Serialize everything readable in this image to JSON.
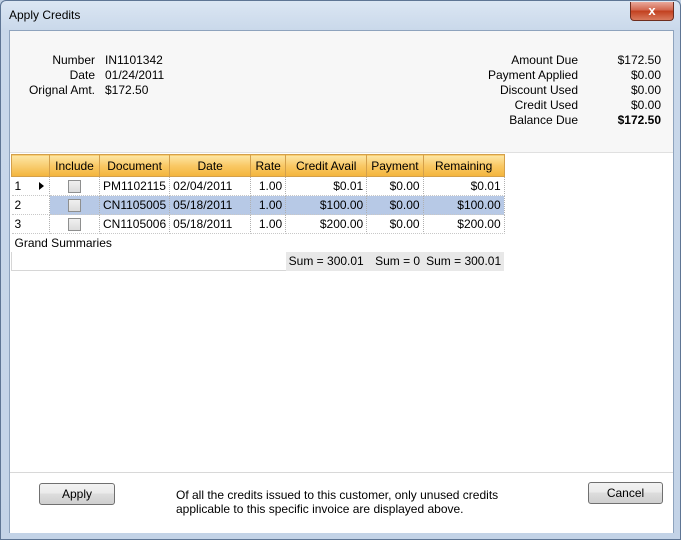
{
  "window": {
    "title": "Apply Credits",
    "close_glyph": "x"
  },
  "invoice": {
    "number_label": "Number",
    "number": "IN1101342",
    "date_label": "Date",
    "date": "01/24/2011",
    "orig_label": "Orignal Amt.",
    "orig": "$172.50"
  },
  "totals": {
    "amount_due_label": "Amount Due",
    "amount_due": "$172.50",
    "payment_applied_label": "Payment Applied",
    "payment_applied": "$0.00",
    "discount_used_label": "Discount Used",
    "discount_used": "$0.00",
    "credit_used_label": "Credit Used",
    "credit_used": "$0.00",
    "balance_due_label": "Balance Due",
    "balance_due": "$172.50"
  },
  "grid": {
    "columns": [
      "Include",
      "Document",
      "Date",
      "Rate",
      "Credit Avail",
      "Payment",
      "Remaining"
    ],
    "rows": [
      {
        "n": "1",
        "document": "PM1102115",
        "date": "02/04/2011",
        "rate": "1.00",
        "credit": "$0.01",
        "payment": "$0.00",
        "remaining": "$0.01"
      },
      {
        "n": "2",
        "document": "CN1105005",
        "date": "05/18/2011",
        "rate": "1.00",
        "credit": "$100.00",
        "payment": "$0.00",
        "remaining": "$100.00"
      },
      {
        "n": "3",
        "document": "CN1105006",
        "date": "05/18/2011",
        "rate": "1.00",
        "credit": "$200.00",
        "payment": "$0.00",
        "remaining": "$200.00"
      }
    ],
    "grand_summaries_label": "Grand Summaries",
    "sums": {
      "credit": "Sum = 300.01",
      "payment": "Sum = 0",
      "remaining": "Sum = 300.01"
    }
  },
  "footer": {
    "apply_label": "Apply",
    "cancel_label": "Cancel",
    "note_line1": "Of all the credits issued to this customer, only unused credits",
    "note_line2": "applicable to this specific invoice are displayed above."
  }
}
